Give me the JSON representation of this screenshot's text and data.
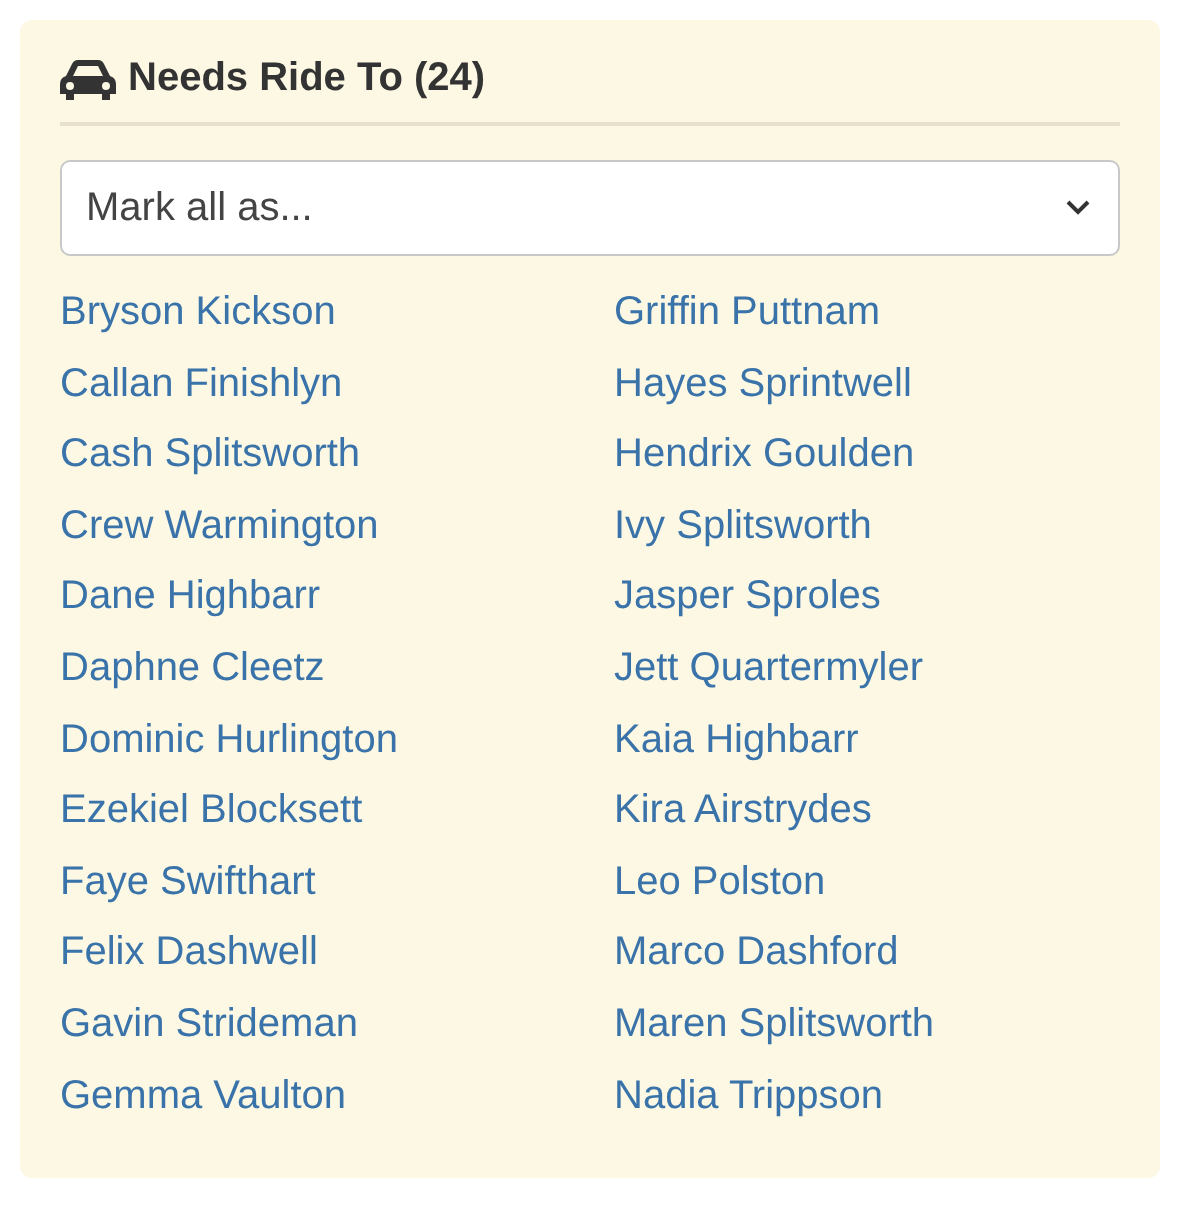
{
  "panel": {
    "title": "Needs Ride To (24)"
  },
  "select": {
    "value": "Mark all as..."
  },
  "names": [
    "Bryson Kickson",
    "Callan Finishlyn",
    "Cash Splitsworth",
    "Crew Warmington",
    "Dane Highbarr",
    "Daphne Cleetz",
    "Dominic Hurlington",
    "Ezekiel Blocksett",
    "Faye Swifthart",
    "Felix Dashwell",
    "Gavin Strideman",
    "Gemma Vaulton",
    "Griffin Puttnam",
    "Hayes Sprintwell",
    "Hendrix Goulden",
    "Ivy Splitsworth",
    "Jasper Sproles",
    "Jett Quartermyler",
    "Kaia Highbarr",
    "Kira Airstrydes",
    "Leo Polston",
    "Marco Dashford",
    "Maren Splitsworth",
    "Nadia Trippson"
  ]
}
